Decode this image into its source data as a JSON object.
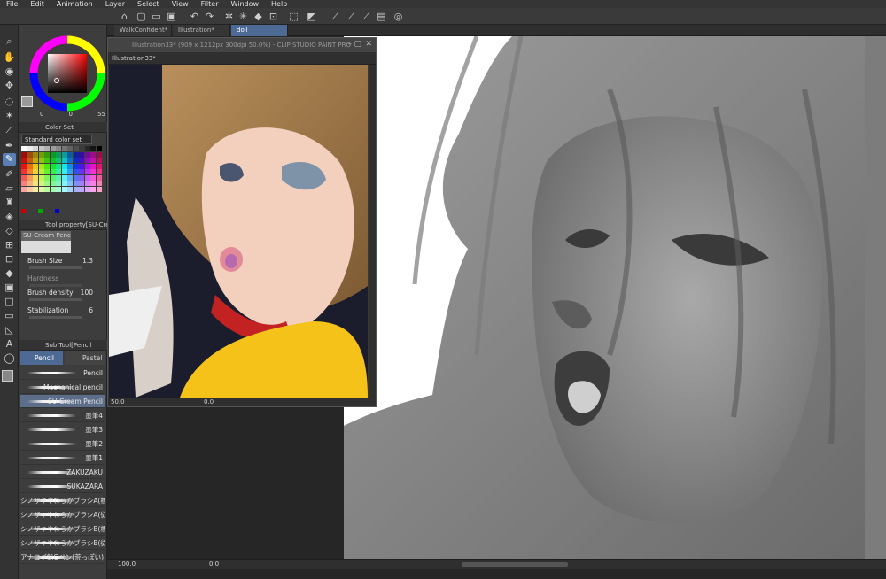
{
  "menu": [
    "File",
    "Edit",
    "Animation",
    "Layer",
    "Select",
    "View",
    "Filter",
    "Window",
    "Help"
  ],
  "tabs": [
    {
      "label": "WalkConfident*",
      "active": false
    },
    {
      "label": "Illustration*",
      "active": false
    },
    {
      "label": "doll",
      "active": true
    }
  ],
  "float_window": {
    "title": "Illustration33* (909 x 1212px 300dpi 50.0%) - CLIP STUDIO PAINT PRO",
    "tab_label": "Illustration33*",
    "zoom": "50.0",
    "angle": "0.0"
  },
  "color_panel": {
    "values": [
      "0",
      "0",
      "55"
    ]
  },
  "color_set": {
    "header": "Color Set",
    "set_name": "Standard color set"
  },
  "tool_property": {
    "header": "Tool property[SU-Cream",
    "brush_name": "SU-Cream Pencil",
    "brush_size_label": "Brush Size",
    "brush_size_value": "1.3",
    "hardness_label": "Hardness",
    "density_label": "Brush density",
    "density_value": "100",
    "stabilization_label": "Stabilization",
    "stabilization_value": "6"
  },
  "subtool": {
    "header": "Sub Tool[Pencil",
    "tab_pencil": "Pencil",
    "tab_pastel": "Pastel",
    "brushes": [
      {
        "label": "Pencil",
        "selected": false
      },
      {
        "label": "Mechanical pencil",
        "selected": false
      },
      {
        "label": "SU-Cream Pencil",
        "selected": true
      },
      {
        "label": "墨筆4",
        "selected": false
      },
      {
        "label": "墨筆3",
        "selected": false
      },
      {
        "label": "墨筆2",
        "selected": false
      },
      {
        "label": "墨筆1",
        "selected": false
      },
      {
        "label": "ZAKUZAKU",
        "selected": false
      },
      {
        "label": "SUKAZARA",
        "selected": false
      },
      {
        "label": "シノザキやわらかブラシA(標準)",
        "selected": false
      },
      {
        "label": "シノザキやわらかブラシA(従)",
        "selected": false
      },
      {
        "label": "シノザキやわらかブラシB(標準)",
        "selected": false
      },
      {
        "label": "シノザキやわらかブラシB(従)",
        "selected": false
      },
      {
        "label": "アナログ鉛Gペン(荒っぽい)",
        "selected": false
      }
    ]
  },
  "canvas_status": {
    "zoom": "100.0",
    "angle": "0.0"
  },
  "icons": [
    "search-icon",
    "hand-icon",
    "zoom-icon",
    "move-icon",
    "lasso-icon",
    "wand-icon",
    "eyedropper-icon",
    "pen-icon",
    "brush-icon",
    "eraser-icon",
    "fill-icon",
    "gradient-icon",
    "text-icon",
    "shape-icon",
    "ruler-icon"
  ],
  "colors": {
    "accent": "#4d6a94",
    "panel": "#3d3d3d",
    "background": "#2b2b2b"
  }
}
